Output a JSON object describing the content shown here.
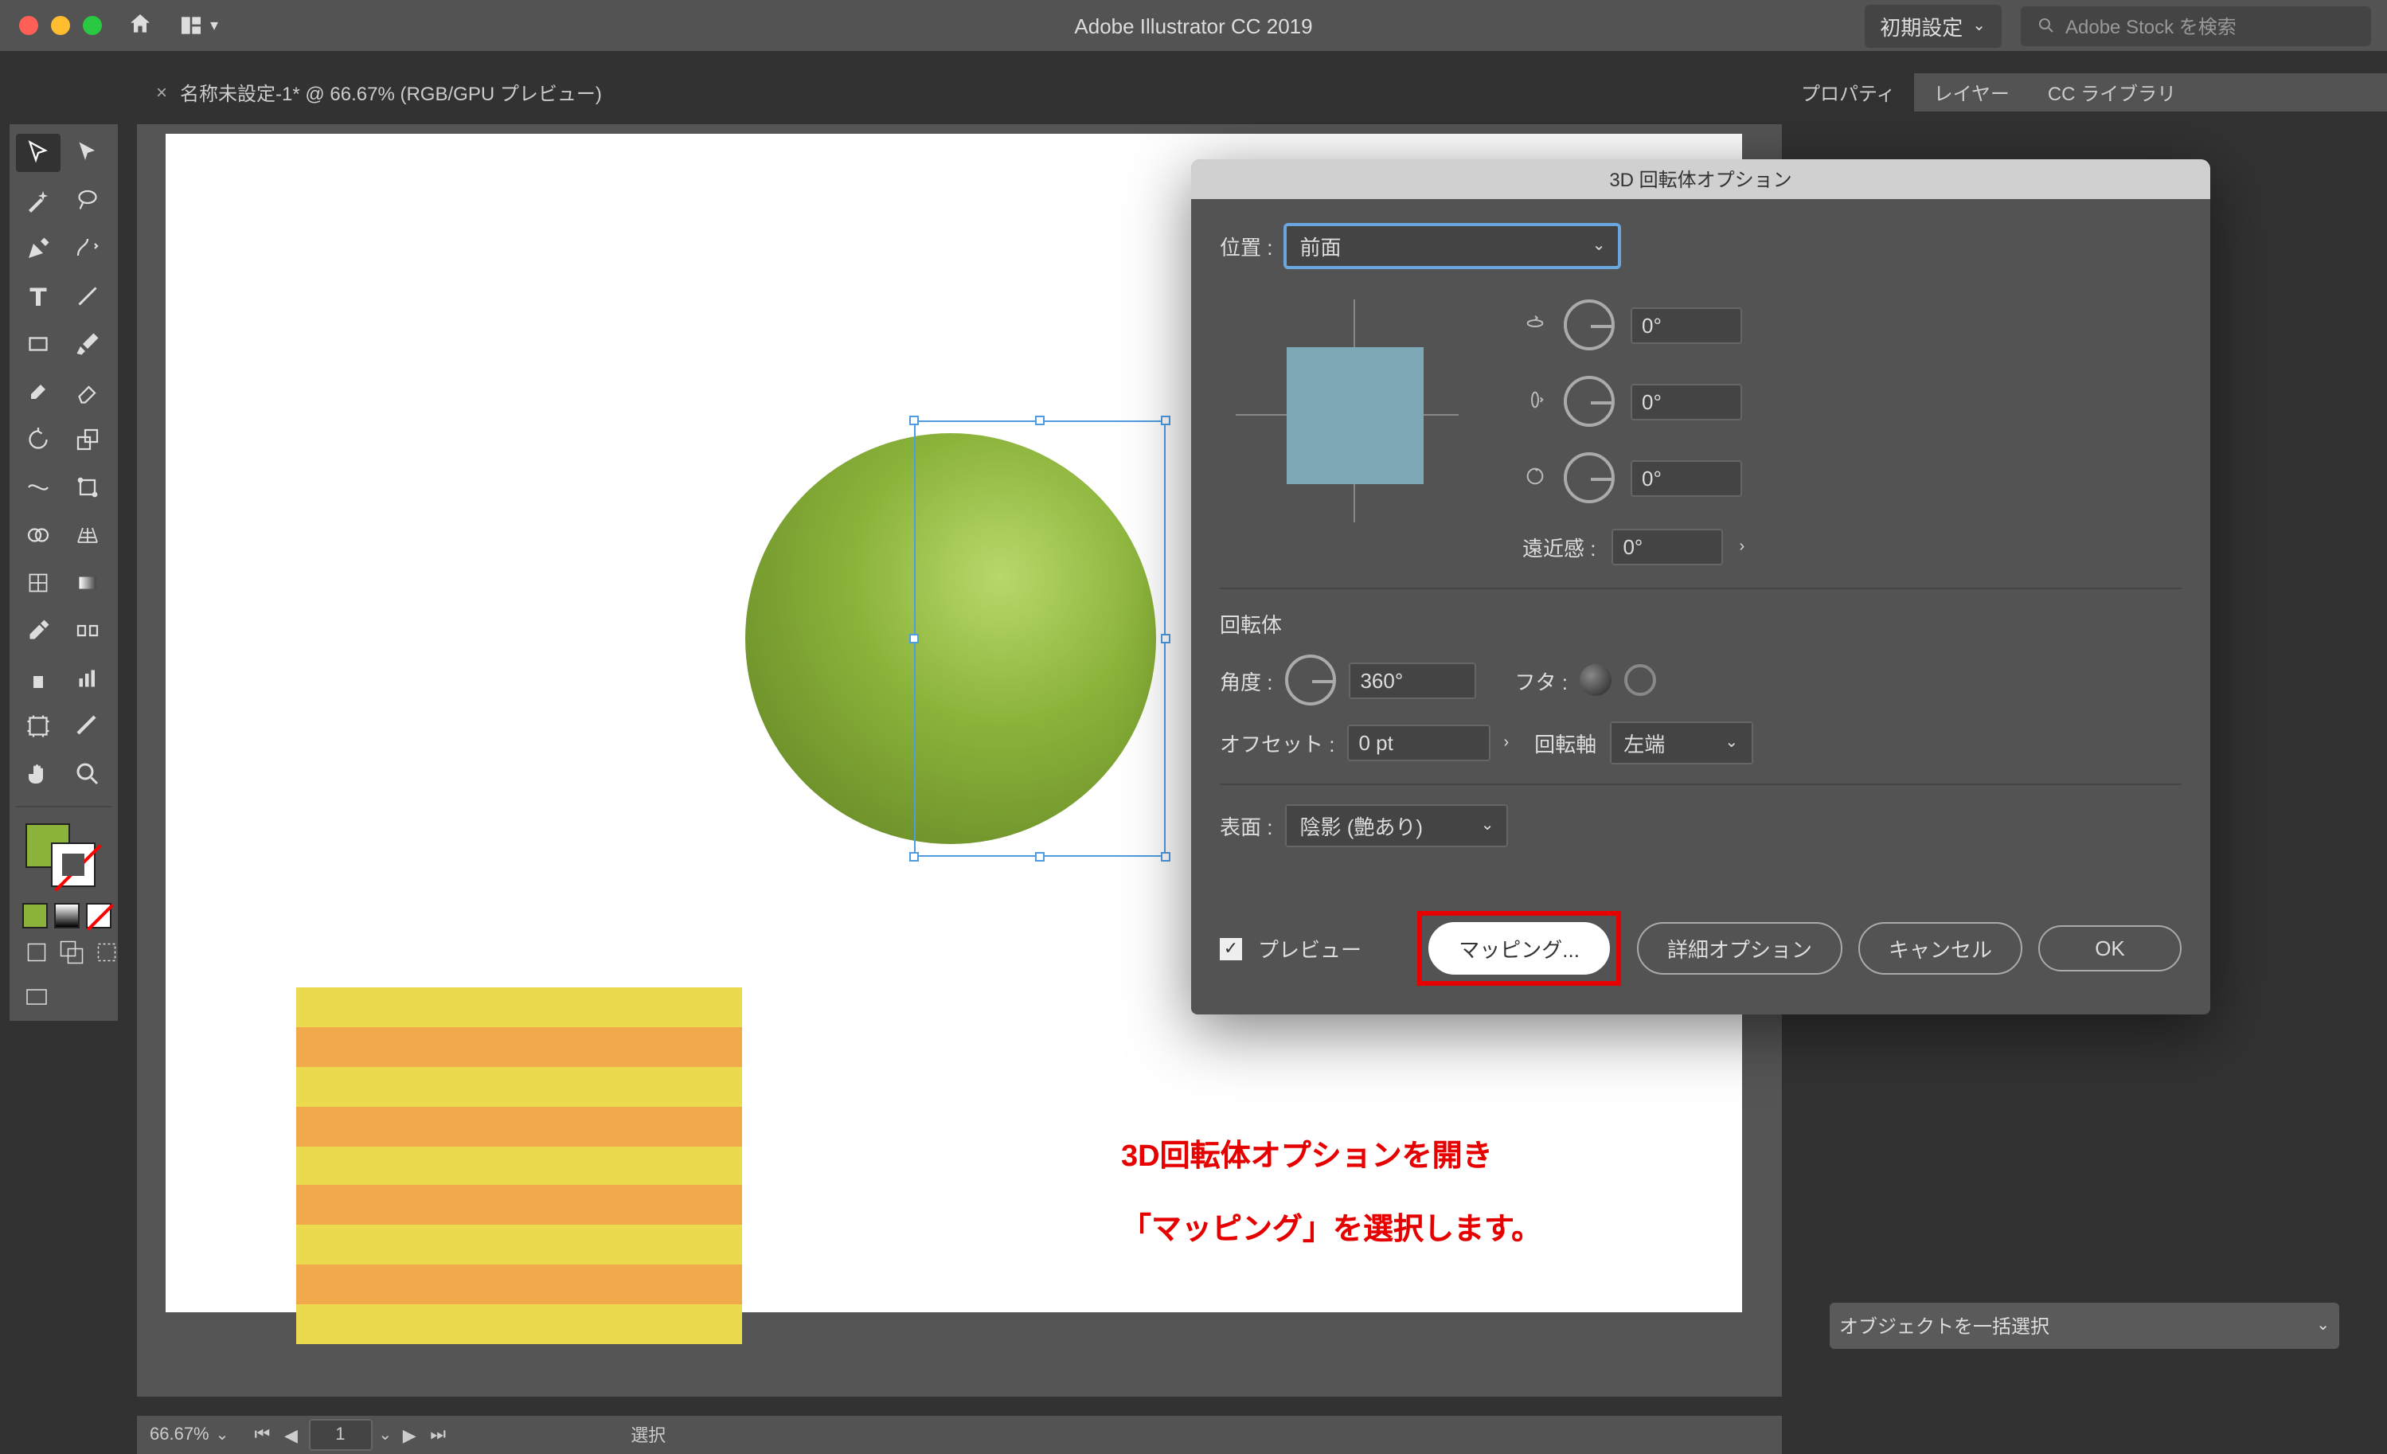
{
  "app_title": "Adobe Illustrator CC 2019",
  "topbar": {
    "workspace_label": "初期設定",
    "search_placeholder": "Adobe Stock を検索"
  },
  "document_tab": {
    "close": "×",
    "title": "名称未設定-1* @ 66.67% (RGB/GPU プレビュー)"
  },
  "right_panel": {
    "tabs": {
      "properties": "プロパティ",
      "layers": "レイヤー",
      "cc_libraries": "CC ライブラリ"
    },
    "recolor_button": "オブジェクトを一括選択"
  },
  "dialog": {
    "title": "3D 回転体オプション",
    "position_label": "位置 :",
    "position_value": "前面",
    "rot_x": "0°",
    "rot_y": "0°",
    "rot_z": "0°",
    "perspective_label": "遠近感 :",
    "perspective_value": "0°",
    "revolve_section": "回転体",
    "angle_label": "角度 :",
    "angle_value": "360°",
    "cap_label": "フタ :",
    "offset_label": "オフセット :",
    "offset_value": "0 pt",
    "axis_label": "回転軸",
    "axis_value": "左端",
    "surface_label": "表面 :",
    "surface_value": "陰影 (艶あり)",
    "preview_label": "プレビュー",
    "map_art_button": "マッピング...",
    "more_options_button": "詳細オプション",
    "cancel_button": "キャンセル",
    "ok_button": "OK"
  },
  "annotation": {
    "line1": "3D回転体オプションを開き",
    "line2": "「マッピング」を選択します。"
  },
  "statusbar": {
    "zoom": "66.67%",
    "artboard_nav": "1",
    "mode": "選択"
  },
  "colors": {
    "fill": "#8bb33a",
    "accent_red": "#e60000"
  }
}
